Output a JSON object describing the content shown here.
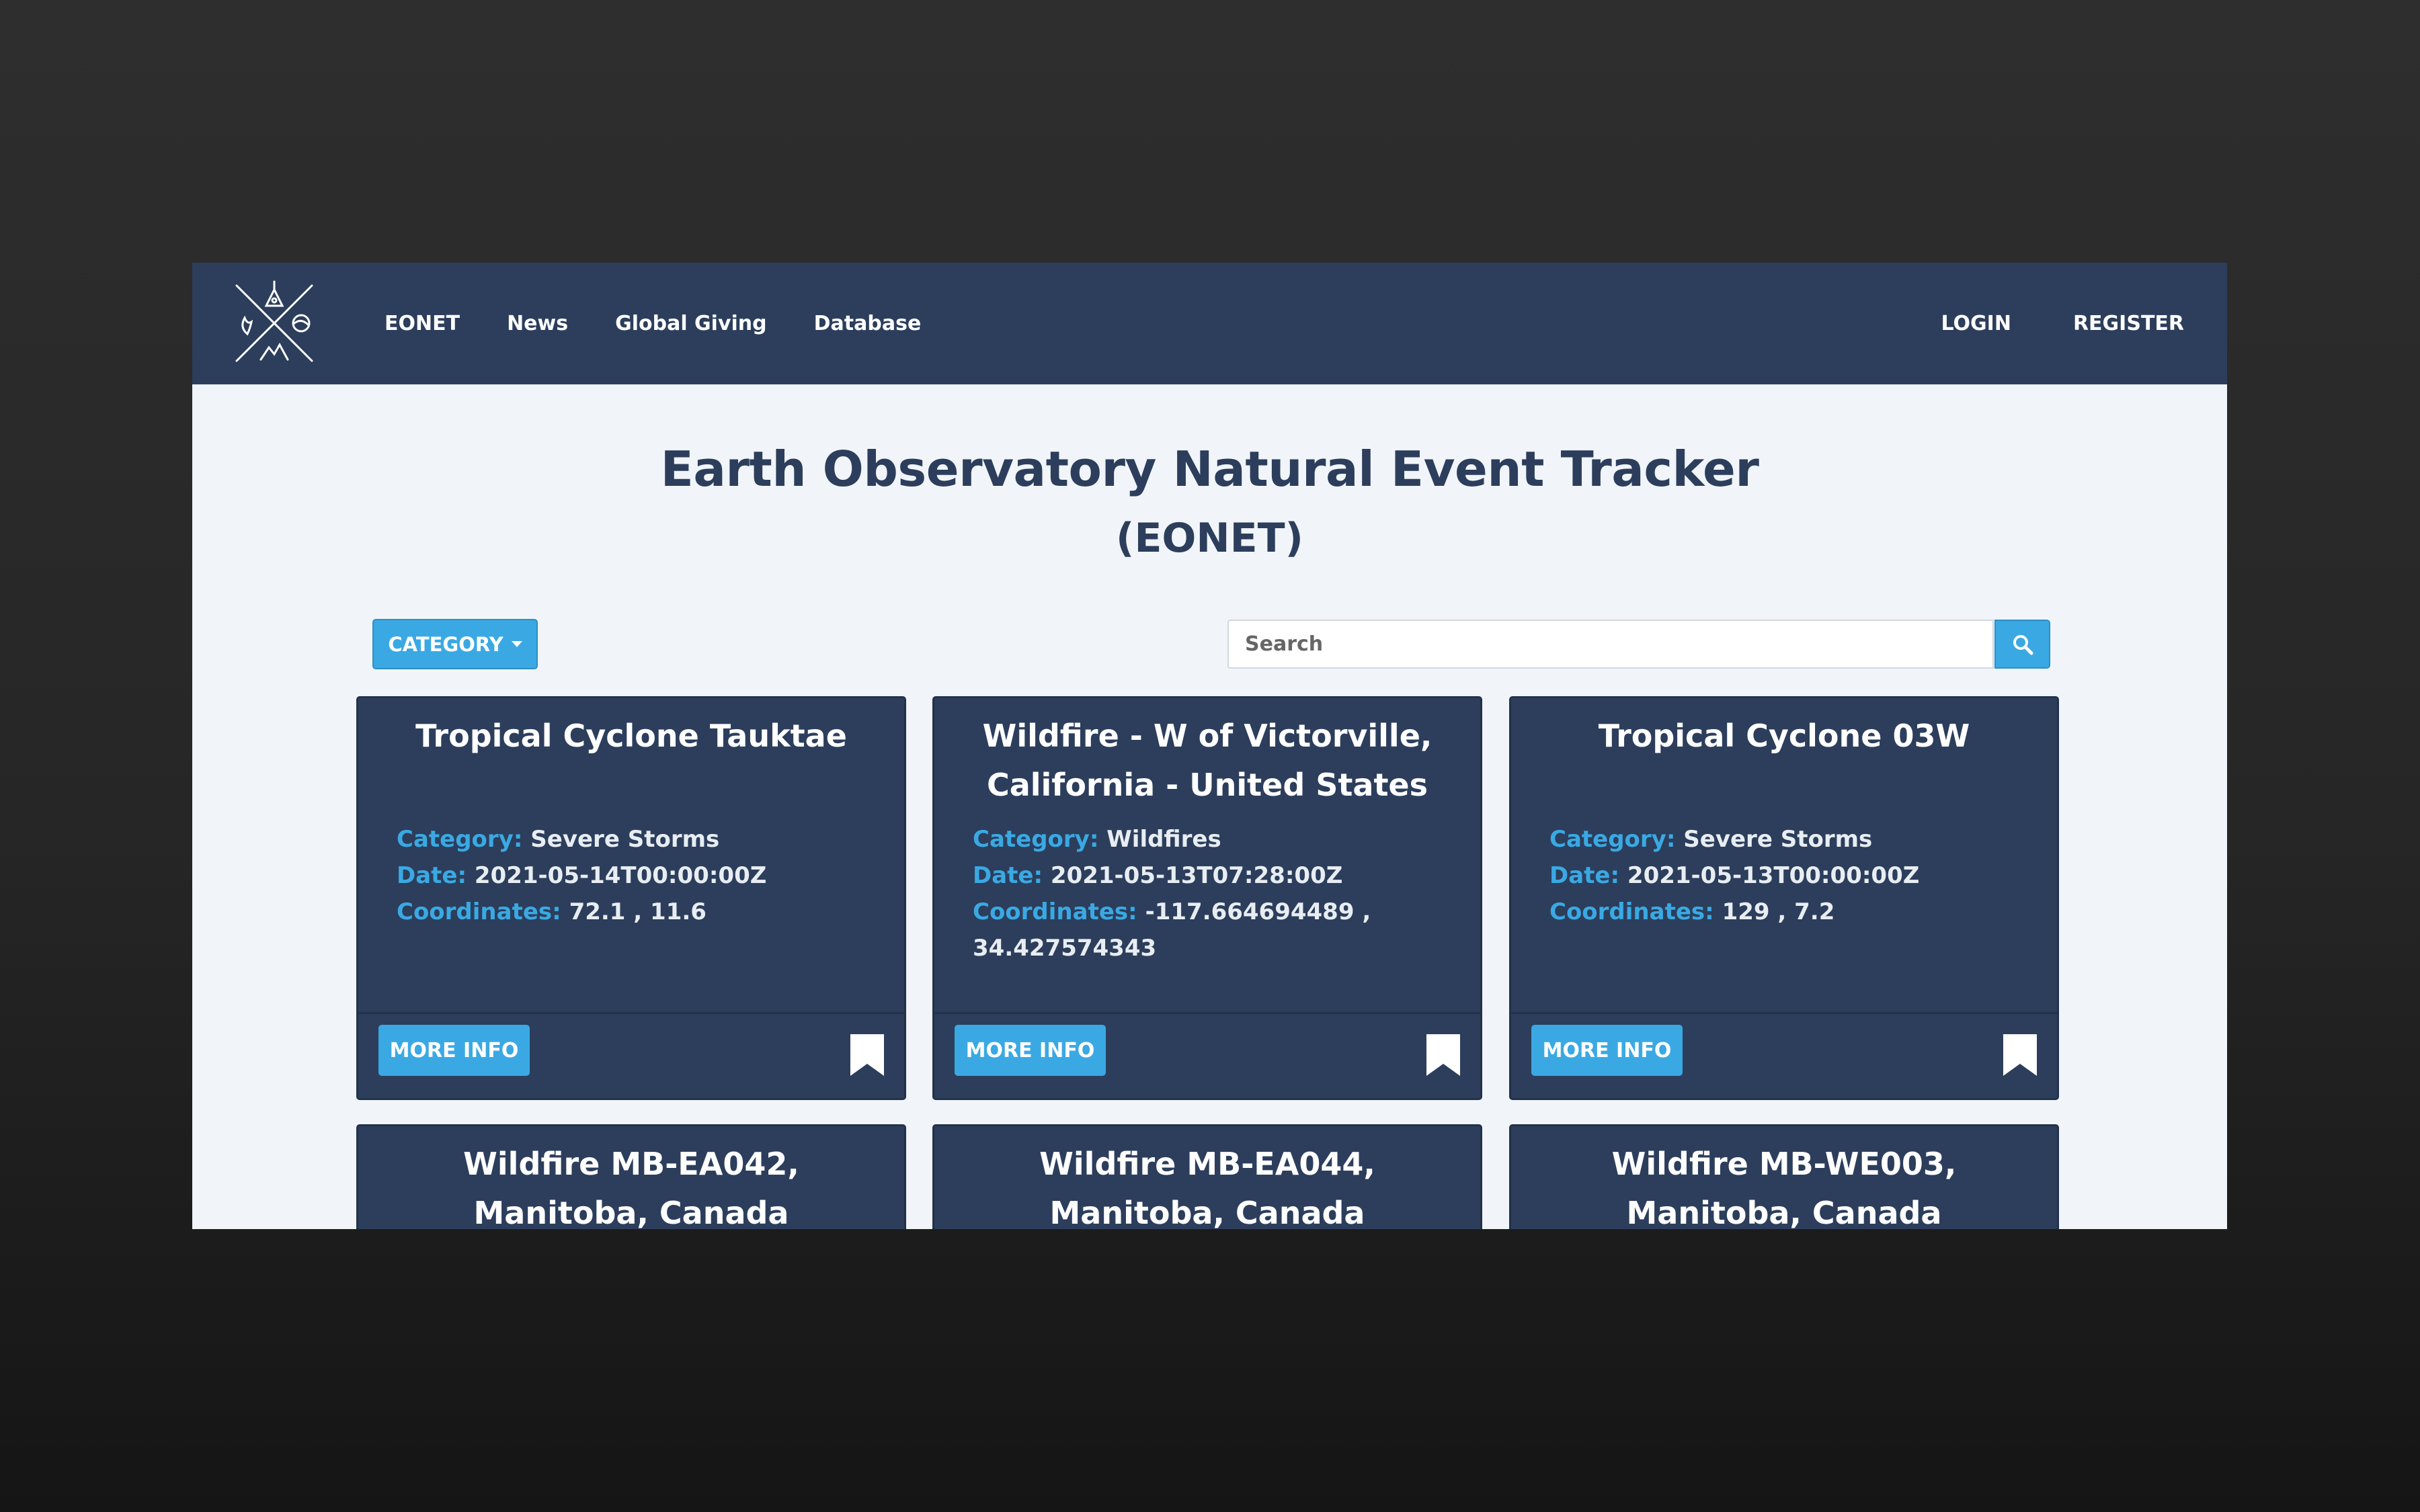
{
  "nav": {
    "links": [
      "EONET",
      "News",
      "Global Giving",
      "Database"
    ],
    "auth": [
      "LOGIN",
      "REGISTER"
    ]
  },
  "header": {
    "title": "Earth Observatory Natural Event Tracker",
    "subtitle": "(EONET)"
  },
  "toolbar": {
    "category_label": "CATEGORY",
    "search_placeholder": "Search"
  },
  "labels": {
    "category": "Category:",
    "date": "Date:",
    "coordinates": "Coordinates:",
    "more_info": "MORE INFO"
  },
  "events": [
    {
      "title": "Tropical Cyclone Tauktae",
      "category": "Severe Storms",
      "date": "2021-05-14T00:00:00Z",
      "coordinates": "72.1 , 11.6"
    },
    {
      "title": "Wildfire - W of Victorville, California - United States",
      "category": "Wildfires",
      "date": "2021-05-13T07:28:00Z",
      "coordinates": "-117.664694489 , 34.427574343"
    },
    {
      "title": "Tropical Cyclone 03W",
      "category": "Severe Storms",
      "date": "2021-05-13T00:00:00Z",
      "coordinates": "129 , 7.2"
    },
    {
      "title": "Wildfire MB-EA042, Manitoba, Canada"
    },
    {
      "title": "Wildfire MB-EA044, Manitoba, Canada"
    },
    {
      "title": "Wildfire MB-WE003, Manitoba, Canada"
    }
  ],
  "colors": {
    "navbar": "#2c3e5c",
    "accent": "#3aa9e3",
    "page_bg": "#f1f5f9"
  }
}
